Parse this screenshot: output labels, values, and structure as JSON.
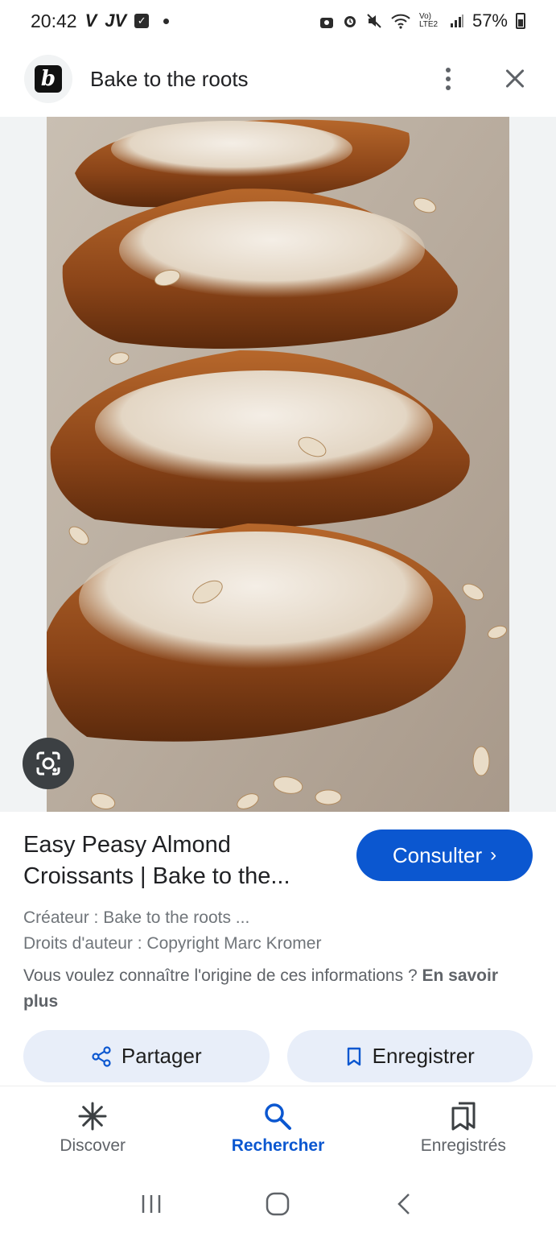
{
  "status_bar": {
    "time": "20:42",
    "app_icons": [
      "V",
      "JV"
    ],
    "battery": "57%",
    "network": "Vo) LTE2"
  },
  "header": {
    "site_logo_letter": "b",
    "title": "Bake to the roots"
  },
  "image": {
    "description_icon": "croissant-photo"
  },
  "result": {
    "title": "Easy Peasy Almond Croissants | Bake to the...",
    "consult_label": "Consulter",
    "creator": "Créateur : Bake to the roots ...",
    "copyright": "Droits d'auteur : Copyright Marc Kromer",
    "source_question": "Vous voulez connaître l'origine de ces informations ?",
    "learn_more": "En savoir plus"
  },
  "actions": {
    "share_label": "Partager",
    "save_label": "Enregistrer"
  },
  "bottom_nav": {
    "items": [
      {
        "label": "Discover",
        "icon": "asterisk-icon"
      },
      {
        "label": "Rechercher",
        "icon": "search-icon"
      },
      {
        "label": "Enregistrés",
        "icon": "saved-icon"
      }
    ],
    "active_index": 1
  },
  "colors": {
    "accent": "#0b57d0",
    "chip_bg": "#e8eef9"
  }
}
